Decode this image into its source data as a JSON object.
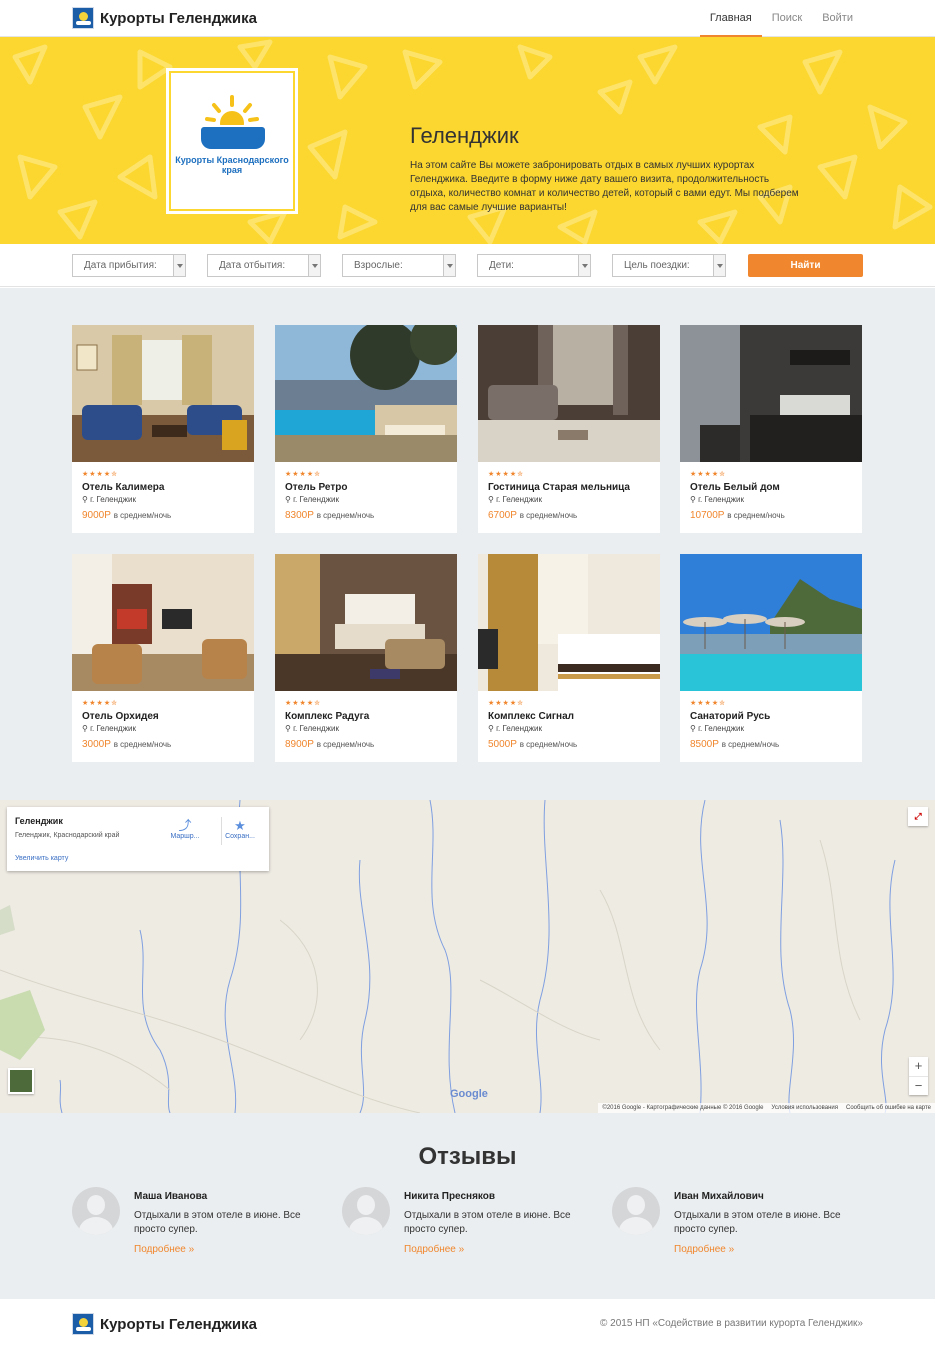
{
  "header": {
    "brand": "Курорты Геленджика",
    "nav": [
      "Главная",
      "Поиск",
      "Войти"
    ]
  },
  "hero": {
    "logo_caption": "Курорты Краснодарского края",
    "title": "Геленджик",
    "description": "На этом сайте Вы можете забронировать отдых в самых лучших курортах Геленджика. Введите в форму ниже дату вашего визита, продолжительность отдыха, количество комнат и количество детей, который с вами едут. Мы подберем для вас самые лучшие варианты!"
  },
  "search": {
    "arrival": "Дата прибытия:",
    "departure": "Дата отбытия:",
    "adults": "Взрослые:",
    "children": "Дети:",
    "purpose": "Цель поездки:",
    "submit": "Найти"
  },
  "hotels": [
    {
      "name": "Отель Калимера",
      "location": "г. Геленджик",
      "price": "9000Р",
      "per_night": "в среднем/ночь",
      "rating": 4.5
    },
    {
      "name": "Отель Ретро",
      "location": "г. Геленджик",
      "price": "8300Р",
      "per_night": "в среднем/ночь",
      "rating": 4.5
    },
    {
      "name": "Гостиница Старая мельница",
      "location": "г. Геленджик",
      "price": "6700Р",
      "per_night": "в среднем/ночь",
      "rating": 4.5
    },
    {
      "name": "Отель Белый дом",
      "location": "г. Геленджик",
      "price": "10700Р",
      "per_night": "в среднем/ночь",
      "rating": 4.5
    },
    {
      "name": "Отель Орхидея",
      "location": "г. Геленджик",
      "price": "3000Р",
      "per_night": "в среднем/ночь",
      "rating": 4.5
    },
    {
      "name": "Комплекс Радуга",
      "location": "г. Геленджик",
      "price": "8900Р",
      "per_night": "в среднем/ночь",
      "rating": 4.5
    },
    {
      "name": "Комплекс Сигнал",
      "location": "г. Геленджик",
      "price": "5000Р",
      "per_night": "в среднем/ночь",
      "rating": 4.5
    },
    {
      "name": "Санаторий Русь",
      "location": "г. Геленджик",
      "price": "8500Р",
      "per_night": "в среднем/ночь",
      "rating": 4.5
    }
  ],
  "map": {
    "place_title": "Геленджик",
    "place_address": "Геленджик, Краснодарский край",
    "enlarge_link": "Увеличить карту",
    "route_label": "Маршр...",
    "save_label": "Сохран...",
    "google_logo": "Google",
    "attribution": "©2016 Google - Картографические данные © 2016 Google",
    "terms": "Условия использования",
    "report": "Сообщить об ошибке на карте",
    "zoom_in": "+",
    "zoom_out": "−"
  },
  "reviews": {
    "title": "Отзывы",
    "items": [
      {
        "name": "Маша Иванова",
        "text": "Отдыхали в этом отеле в июне. Все просто супер.",
        "more": "Подробнее »"
      },
      {
        "name": "Никита Пресняков",
        "text": "Отдыхали в этом отеле в июне. Все просто супер.",
        "more": "Подробнее »"
      },
      {
        "name": "Иван Михайлович",
        "text": "Отдыхали в этом отеле в июне. Все просто супер.",
        "more": "Подробнее »"
      }
    ]
  },
  "footer": {
    "brand": "Курорты Геленджика",
    "copyright": "© 2015 НП «Содействие в развитии курорта Геленджик»"
  },
  "colors": {
    "accent": "#f0862d",
    "hero_bg": "#fbd72f",
    "section_bg": "#ebeef0",
    "map_bg": "#eeebe3"
  }
}
